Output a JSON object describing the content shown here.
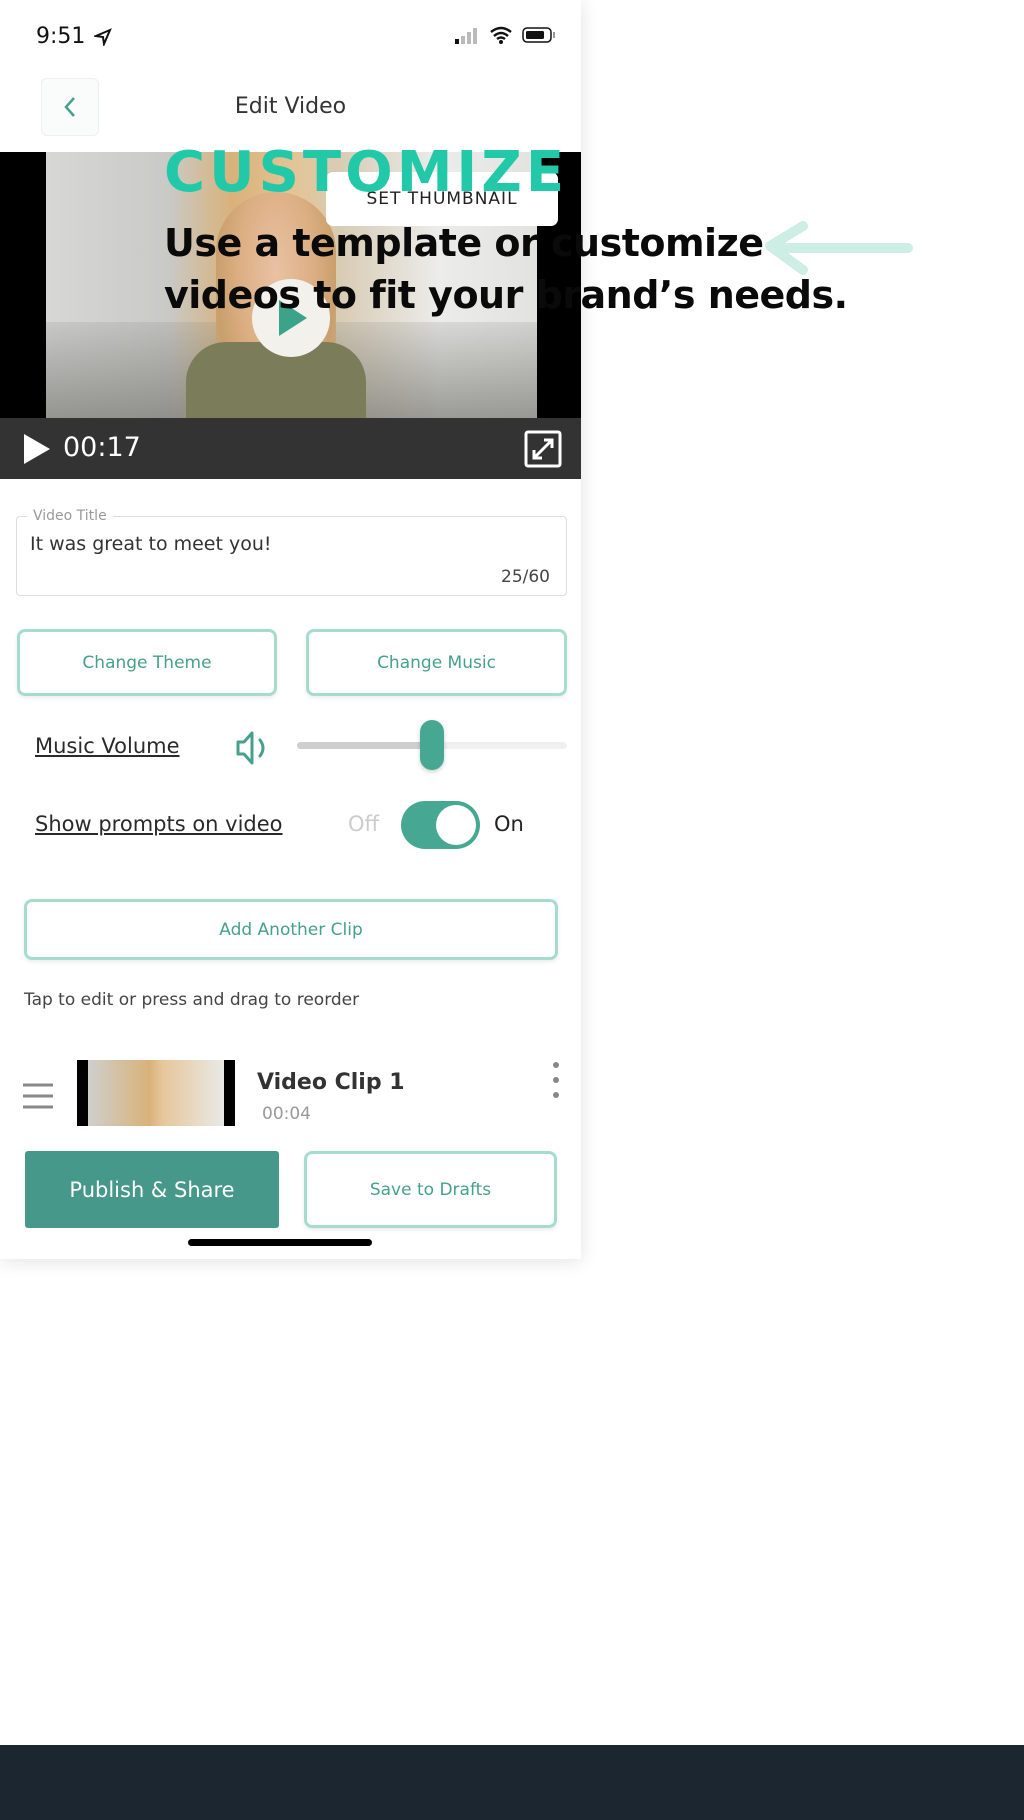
{
  "promo": {
    "headline": "CUSTOMIZE",
    "subline1": "Use a template or customize",
    "subline2": "videos to fit your brand’s needs.",
    "accent": "#22c9a8",
    "arrow_icon": "arrow-left-icon"
  },
  "status_bar": {
    "time": "9:51",
    "icons": [
      "location-arrow-icon",
      "signal-icon",
      "wifi-icon",
      "battery-icon"
    ]
  },
  "header": {
    "title": "Edit Video",
    "back_icon": "chevron-left-icon"
  },
  "video": {
    "set_thumbnail_label": "SET THUMBNAIL",
    "time": "00:17"
  },
  "title_field": {
    "label": "Video Title",
    "value": "It was great to meet you!",
    "counter": "25/60"
  },
  "buttons": {
    "change_theme": "Change Theme",
    "change_music": "Change Music",
    "add_clip": "Add Another Clip",
    "publish": "Publish & Share",
    "save_drafts": "Save to Drafts"
  },
  "music_volume": {
    "label": "Music Volume",
    "level": 0.5
  },
  "prompts": {
    "label": "Show prompts on video",
    "off": "Off",
    "on": "On",
    "enabled": true
  },
  "hint": "Tap to edit or press and drag to reorder",
  "clips": [
    {
      "name": "Video Clip 1",
      "duration": "00:04"
    }
  ],
  "colors": {
    "primary": "#46a08d",
    "outline": "#a6dccd",
    "footer": "#1c2630"
  }
}
